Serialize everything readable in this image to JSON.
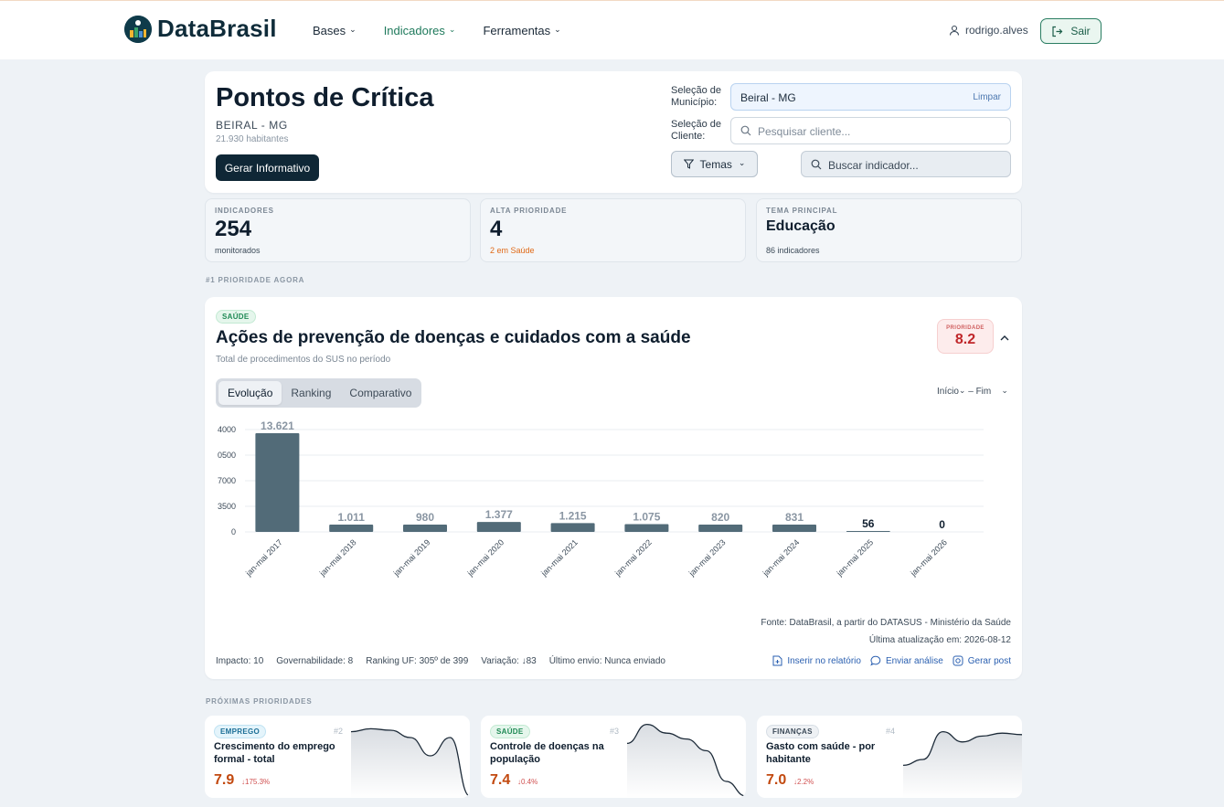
{
  "brand": {
    "name": "DataBrasil"
  },
  "nav": [
    {
      "label": "Bases",
      "active": false
    },
    {
      "label": "Indicadores",
      "active": true
    },
    {
      "label": "Ferramentas",
      "active": false
    }
  ],
  "user": {
    "name": "rodrigo.alves",
    "logout_label": "Sair"
  },
  "header": {
    "title": "Pontos de Crítica",
    "location": "BEIRAL - MG",
    "population": "21.930 habitantes",
    "generate_button": "Gerar Informativo",
    "municipio_label": "Seleção de Município:",
    "municipio_value": "Beiral - MG",
    "clear_label": "Limpar",
    "cliente_label": "Seleção de Cliente:",
    "cliente_placeholder": "Pesquisar cliente...",
    "temas_label": "Temas",
    "indicador_placeholder": "Buscar indicador..."
  },
  "stats": [
    {
      "label": "INDICADORES",
      "value": "254",
      "sub": "monitorados"
    },
    {
      "label": "ALTA PRIORIDADE",
      "value": "4",
      "sub": "2 em Saúde"
    },
    {
      "label": "TEMA PRINCIPAL",
      "value": "Educação",
      "sub": "86 indicadores"
    }
  ],
  "priority_section_label": "#1 PRIORIDADE AGORA",
  "main": {
    "tag": "SAÚDE",
    "title": "Ações de prevenção de doenças e cuidados com a saúde",
    "subtitle": "Total de procedimentos do SUS no período",
    "priority_label": "PRIORIDADE",
    "priority_value": "8.2",
    "tabs": [
      "Evolução",
      "Ranking",
      "Comparativo"
    ],
    "range_start": "Início",
    "range_end": "Fim",
    "source": "Fonte: DataBrasil, a partir do DATASUS - Ministério da Saúde",
    "updated": "Última atualização em: 2026-08-12",
    "footer": {
      "impacto": "Impacto: 10",
      "governabilidade": "Governabilidade: 8",
      "ranking": "Ranking UF: 305º de 399",
      "variacao": "Variação: ↓83",
      "envio": "Último envio: Nunca enviado"
    },
    "actions": {
      "insert": "Inserir no relatório",
      "send": "Enviar análise",
      "post": "Gerar post"
    }
  },
  "chart_data": {
    "type": "bar",
    "categories": [
      "jan-mai 2017",
      "jan-mai 2018",
      "jan-mai 2019",
      "jan-mai 2020",
      "jan-mai 2021",
      "jan-mai 2022",
      "jan-mai 2023",
      "jan-mai 2024",
      "jan-mai 2025",
      "jan-mai 2026"
    ],
    "values": [
      13621,
      1011,
      980,
      1377,
      1215,
      1075,
      820,
      831,
      56,
      0
    ],
    "value_labels": [
      "13.621",
      "1.011",
      "980",
      "1.377",
      "1.215",
      "1.075",
      "820",
      "831",
      "56",
      "0"
    ],
    "y_ticks": [
      "4000",
      "0500",
      "7000",
      "3500",
      "0"
    ],
    "ylim": [
      0,
      14000
    ],
    "grid": true,
    "bar_color": "#526b78"
  },
  "next_section_label": "PRÓXIMAS PRIORIDADES",
  "next": [
    {
      "tag": "EMPREGO",
      "tag_style": "emprego",
      "rank": "#2",
      "title": "Crescimento do emprego formal - total",
      "value": "7.9",
      "delta": "↓175.3%",
      "trend": [
        0.88,
        0.92,
        0.9,
        0.8,
        0.55,
        0.8,
        0.0
      ]
    },
    {
      "tag": "SAÚDE",
      "tag_style": "saude",
      "rank": "#3",
      "title": "Controle de doenças na população",
      "value": "7.4",
      "delta": "↓0.4%",
      "trend": [
        0.72,
        0.98,
        0.86,
        0.78,
        0.62,
        0.2,
        0.0
      ]
    },
    {
      "tag": "FINANÇAS",
      "tag_style": "financas",
      "rank": "#4",
      "title": "Gasto com saúde - por habitante",
      "value": "7.0",
      "delta": "↓2.2%",
      "trend": [
        0.42,
        0.5,
        0.88,
        0.74,
        0.82,
        0.86,
        0.84
      ]
    }
  ]
}
